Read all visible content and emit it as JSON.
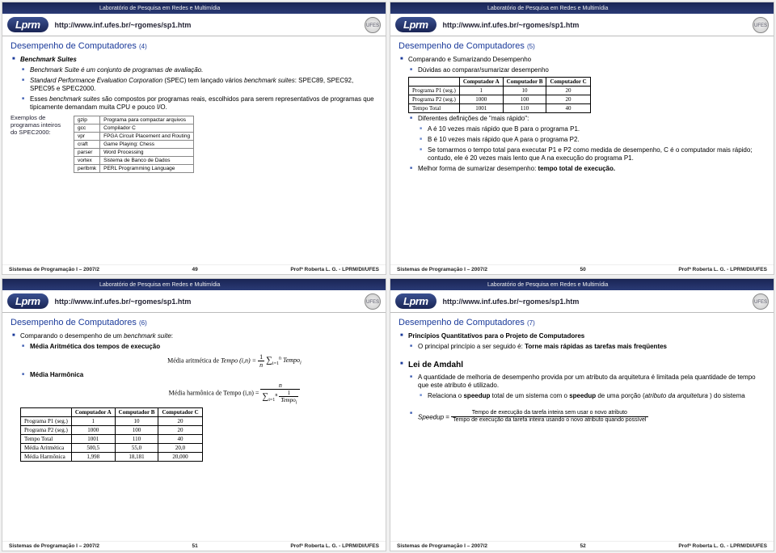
{
  "lab": "Laboratório de Pesquisa em Redes e Multimídia",
  "logo": "Lprm",
  "url": "http://www.inf.ufes.br/~rgomes/sp1.htm",
  "footerL": "Sistemas de Programação I – 2007/2",
  "footerR": "Profª Roberta L. G. - LPRM/DI/UFES",
  "crest": "UFES",
  "slides": [
    {
      "title": "Desempenho de Computadores",
      "num": "(4)",
      "page": "49",
      "h1": "Benchmark Suites",
      "b1": "Benchmark Suite é um conjunto de programas de avaliação.",
      "b2a": "Standard Performance Evaluation Corporation",
      "b2b": " (SPEC) tem lançado vários ",
      "b2c": "benchmark suites",
      "b2d": ": SPEC89, SPEC92, SPEC95 e SPEC2000.",
      "b3a": "Esses ",
      "b3b": "benchmark suites",
      "b3c": " são compostos por programas reais, escolhidos para serem representativos de programas que tipicamente demandam muita CPU e pouco I/O.",
      "exLabel": "Exemplos de programas inteiros do SPEC2000:",
      "spec": [
        [
          "gzip",
          "Programa para compactar arquivos"
        ],
        [
          "gcc",
          "Compilador C"
        ],
        [
          "vpr",
          "FPGA Circuit Placement and Routing"
        ],
        [
          "craft",
          "Game Playing: Chess"
        ],
        [
          "parser",
          "Word Processing"
        ],
        [
          "vortex",
          "Sistema de Banco de Dados"
        ],
        [
          "perlbmk",
          "PERL Programming Language"
        ]
      ]
    },
    {
      "title": "Desempenho de Computadores",
      "num": "(5)",
      "page": "50",
      "h1": "Comparando e Sumarizando Desempenho",
      "b1": "Dúvidas ao comparar/sumarizar desempenho",
      "tbl": {
        "head": [
          "",
          "Computador A",
          "Computador B",
          "Computador C"
        ],
        "rows": [
          [
            "Programa P1 (seg.)",
            "1",
            "10",
            "20"
          ],
          [
            "Programa P2 (seg.)",
            "1000",
            "100",
            "20"
          ],
          [
            "Tempo Total",
            "1001",
            "110",
            "40"
          ]
        ]
      },
      "b2": "Diferentes definições de \"mais rápido\":",
      "b3": "A é 10 vezes mais rápido que B para o programa P1.",
      "b4": "B é 10 vezes mais rápido que A para o programa P2.",
      "b5": "Se tomarmos o tempo total para executar P1 e P2 como medida de desempenho, C é o computador mais rápido; contudo, ele é 20 vezes mais lento que A na execução do programa P1.",
      "b6a": "Melhor forma de sumarizar desempenho: ",
      "b6b": "tempo total de execução."
    },
    {
      "title": "Desempenho de Computadores",
      "num": "(6)",
      "page": "51",
      "h1a": "Comparando o desempenho de um ",
      "h1b": "benchmark suite",
      "h1c": ":",
      "b1": "Média Aritmética dos tempos de execução",
      "f1a": "Média aritmética de ",
      "f1b": "Tempo (i,n) = ",
      "b2": "Média Harmônica",
      "f2": "Média harmônica de Tempo (i,n) = ",
      "tbl": {
        "head": [
          "",
          "Computador A",
          "Computador B",
          "Computador C"
        ],
        "rows": [
          [
            "Programa P1 (seg.)",
            "1",
            "10",
            "20"
          ],
          [
            "Programa P2 (seg.)",
            "1000",
            "100",
            "20"
          ],
          [
            "Tempo Total",
            "1001",
            "110",
            "40"
          ],
          [
            "Média Aritmética",
            "500,5",
            "55,0",
            "20,0"
          ],
          [
            "Média Harmônica",
            "1,998",
            "18,181",
            "20,000"
          ]
        ]
      }
    },
    {
      "title": "Desempenho de Computadores",
      "num": "(7)",
      "page": "52",
      "h1": "Princípios Quantitativos para o Projeto de Computadores",
      "b1a": "O principal princípio a ser seguido é: ",
      "b1b": "Torne mais rápidas as tarefas mais freqüentes",
      "h2": "Lei de Amdahl",
      "b2": "A quantidade de melhoria de desempenho provida por um atributo da arquitetura é limitada pela quantidade de tempo que este atributo é utilizado.",
      "b3a": "Relaciona o ",
      "b3b": "speedup",
      "b3c": " total de um sistema com o ",
      "b3d": "speedup",
      "b3e": " de uma porção (",
      "b3f": "atributo da arquitetura",
      "b3g": " ) do sistema",
      "b4a": "Speedup",
      "b4b": " = ",
      "b4c": "Tempo de execução da tarefa inteira sem usar o novo atributo",
      "b4d": "Tempo de execução da tarefa inteira usando o novo atributo quando possível"
    }
  ]
}
